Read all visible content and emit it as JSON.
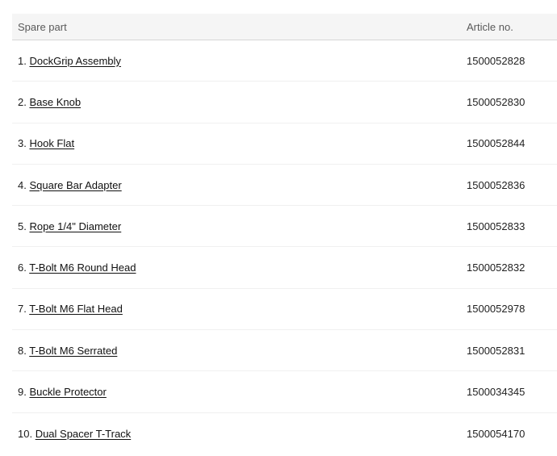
{
  "table": {
    "headers": {
      "spare_part": "Spare part",
      "article_no": "Article no."
    },
    "rows": [
      {
        "number": "1.",
        "name": "DockGrip Assembly",
        "article": "1500052828"
      },
      {
        "number": "2.",
        "name": "Base Knob",
        "article": "1500052830"
      },
      {
        "number": "3.",
        "name": "Hook Flat",
        "article": "1500052844"
      },
      {
        "number": "4.",
        "name": "Square Bar Adapter",
        "article": "1500052836"
      },
      {
        "number": "5.",
        "name": "Rope 1/4\" Diameter",
        "article": "1500052833"
      },
      {
        "number": "6.",
        "name": "T-Bolt M6 Round Head",
        "article": "1500052832"
      },
      {
        "number": "7.",
        "name": "T-Bolt M6 Flat Head",
        "article": "1500052978"
      },
      {
        "number": "8.",
        "name": "T-Bolt M6 Serrated",
        "article": "1500052831"
      },
      {
        "number": "9.",
        "name": "Buckle Protector",
        "article": "1500034345"
      },
      {
        "number": "10.",
        "name": "Dual Spacer T-Track",
        "article": "1500054170"
      }
    ]
  }
}
